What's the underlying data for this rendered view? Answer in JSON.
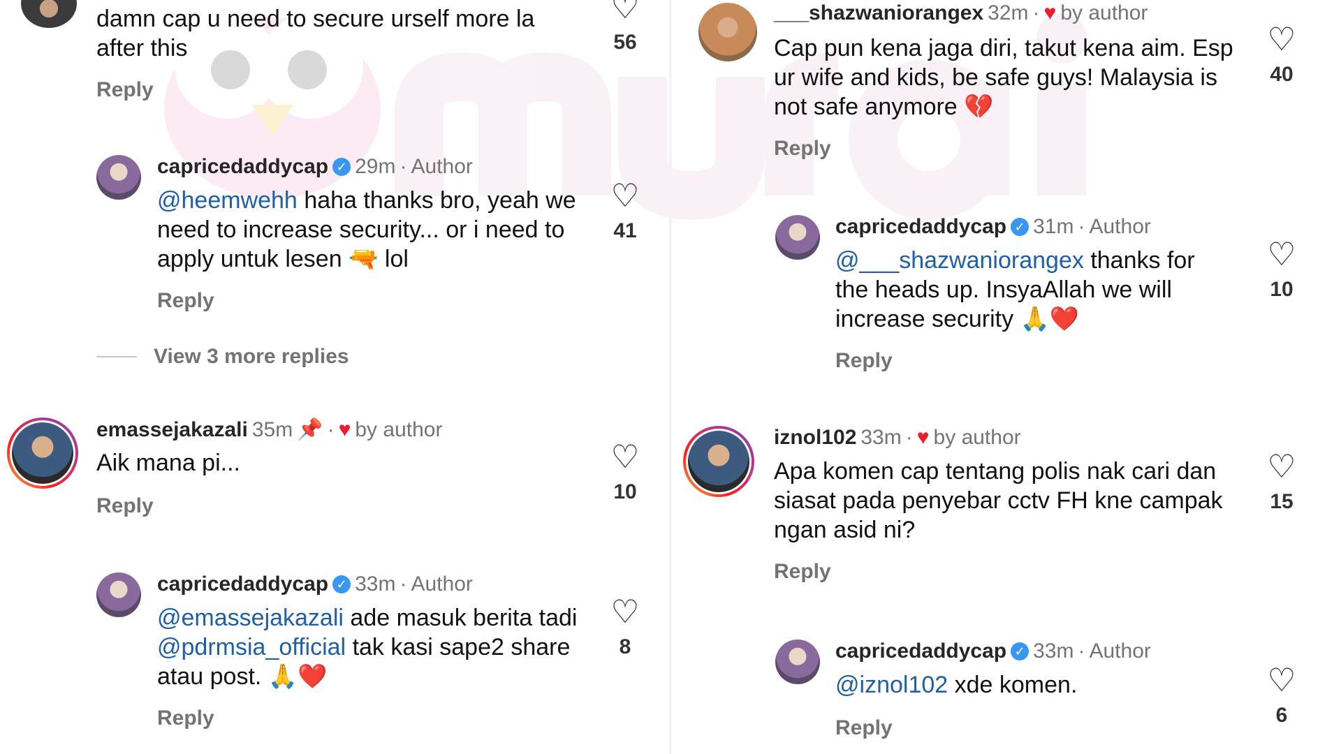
{
  "left": {
    "c0": {
      "text": "damn cap u need to secure urself more la after this",
      "reply": "Reply",
      "likes": "56"
    },
    "c1": {
      "user": "capricedaddycap",
      "time": "29m",
      "role": "Author",
      "mention": "@heemwehh",
      "text": "haha thanks bro, yeah we need to increase security... or i need to apply untuk lesen",
      "emoji": "🔫",
      "text_end": "lol",
      "reply": "Reply",
      "likes": "41"
    },
    "view_more": "View 3 more replies",
    "c2": {
      "user": "emassejakazali",
      "time": "35m",
      "pin": "📌",
      "liked_by": "by author",
      "text": "Aik mana pi...",
      "reply": "Reply",
      "likes": "10"
    },
    "c3": {
      "user": "capricedaddycap",
      "time": "33m",
      "role": "Author",
      "mention1": "@emassejakazali",
      "text1": "ade masuk berita tadi",
      "mention2": "@pdrmsia_official",
      "text2": "tak kasi sape2 share atau post.",
      "emoji": "🙏❤️",
      "reply": "Reply",
      "likes": "8"
    }
  },
  "right": {
    "c0": {
      "user": "___shazwaniorangex",
      "time": "32m",
      "liked_by": "by author",
      "text": "Cap pun kena jaga diri, takut kena aim. Esp ur wife and kids, be safe guys! Malaysia is not safe anymore",
      "emoji": "💔",
      "reply": "Reply",
      "likes": "40"
    },
    "c1": {
      "user": "capricedaddycap",
      "time": "31m",
      "role": "Author",
      "mention": "@___shazwaniorangex",
      "text": "thanks for the heads up. InsyaAllah we will increase security",
      "emoji": "🙏❤️",
      "reply": "Reply",
      "likes": "10"
    },
    "c2": {
      "user": "iznol102",
      "time": "33m",
      "liked_by": "by author",
      "text": "Apa komen cap tentang polis nak cari dan siasat pada penyebar cctv FH kne campak ngan asid ni?",
      "reply": "Reply",
      "likes": "15"
    },
    "c3": {
      "user": "capricedaddycap",
      "time": "33m",
      "role": "Author",
      "mention": "@iznol102",
      "text": "xde komen.",
      "reply": "Reply",
      "likes": "6"
    }
  },
  "icons": {
    "like": "heart-outline-icon",
    "verified": "verified-badge-icon",
    "liked_by_author": "heart-filled-icon",
    "pinned": "pin-icon"
  },
  "colors": {
    "mention": "#1e5fa8",
    "heart_red": "#ed1e2c",
    "verified_blue": "#3897f0",
    "meta_gray": "#737373"
  }
}
